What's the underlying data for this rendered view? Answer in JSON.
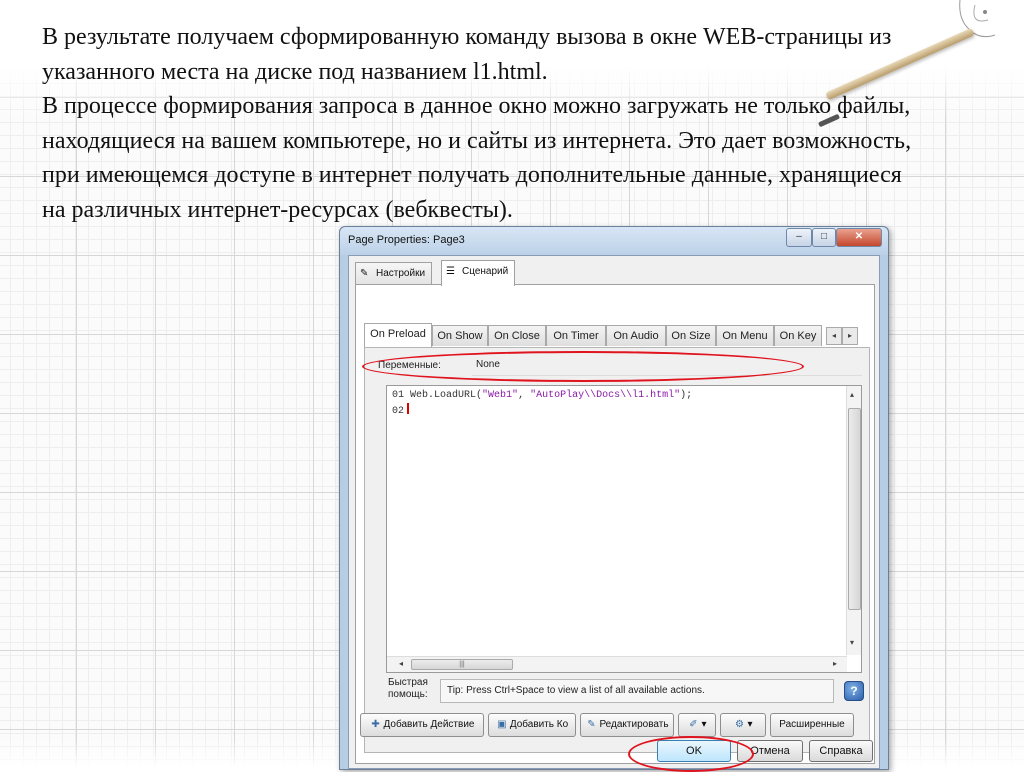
{
  "slide": {
    "paragraph1": "В результате получаем сформированную команду вызова в окне WEB-страницы из указанного места на диске под названием l1.html.",
    "paragraph2": "В процессе формирования запроса в данное окно можно загружать не только файлы, находящиеся на вашем компьютере, но и сайты из интернета. Это дает возможность, при имеющемся доступе в интернет получать дополнительные данные, хранящиеся на различных интернет-ресурсах (вебквесты)."
  },
  "window": {
    "title": "Page Properties: Page3",
    "titlebar_buttons": {
      "minimize": "–",
      "maximize": "□",
      "close": "✕"
    },
    "outer_tabs": [
      {
        "label": "Настройки",
        "icon": "settings-icon",
        "active": false
      },
      {
        "label": "Сценарий",
        "icon": "script-icon",
        "active": true
      }
    ],
    "inner_tabs": [
      {
        "label": "On Preload",
        "active": true
      },
      {
        "label": "On Show",
        "active": false
      },
      {
        "label": "On Close",
        "active": false
      },
      {
        "label": "On Timer",
        "active": false
      },
      {
        "label": "On Audio",
        "active": false
      },
      {
        "label": "On Size",
        "active": false
      },
      {
        "label": "On Menu",
        "active": false
      },
      {
        "label": "On Key",
        "active": false
      }
    ],
    "tab_scroll": {
      "left": "◂",
      "right": "▸"
    },
    "variables_label": "Переменные:",
    "variables_value": "None",
    "editor": {
      "lines": [
        {
          "num": "01",
          "code_prefix": "Web.LoadURL(",
          "arg1": "\"Web1\"",
          "sep": ", ",
          "arg2": "\"AutoPlay\\\\Docs\\\\l1.html\"",
          "code_suffix": ");"
        },
        {
          "num": "02",
          "code": ""
        }
      ]
    },
    "quick_help_label": "Быстрая помощь:",
    "tip": "Tip: Press Ctrl+Space to view a list of all available actions.",
    "help_button": "?",
    "action_buttons": [
      {
        "label": "Добавить Действие",
        "icon": "add-action-icon"
      },
      {
        "label": "Добавить Ко",
        "icon": "add-code-icon"
      },
      {
        "label": "Редактировать",
        "icon": "edit-icon"
      },
      {
        "label": "▾",
        "icon": "wand-icon"
      },
      {
        "label": "▾",
        "icon": "script-tools-icon"
      },
      {
        "label": "Расширенные",
        "icon": ""
      }
    ],
    "dialog_buttons": {
      "ok": "OK",
      "cancel": "Отмена",
      "help": "Справка"
    },
    "highlight_color": "#e0141e"
  }
}
